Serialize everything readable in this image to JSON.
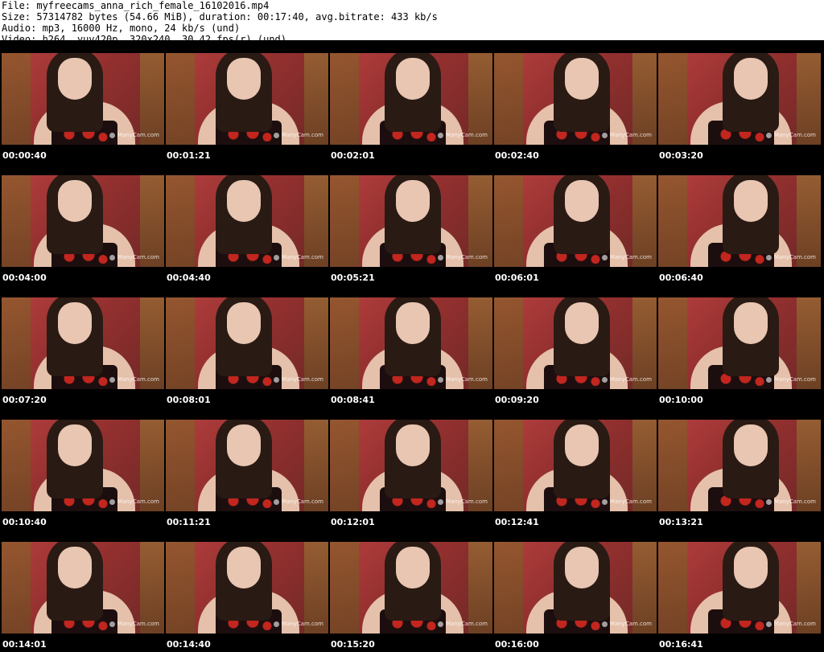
{
  "header": {
    "file": "File: myfreecams_anna_rich_female_16102016.mp4",
    "size": "Size: 57314782 bytes (54.66 MiB), duration: 00:17:40, avg.bitrate: 433 kb/s",
    "audio": "Audio: mp3, 16000 Hz, mono, 24 kb/s (und)",
    "video": "Video: h264, yuv420p, 320x240, 30.42 fps(r) (und)"
  },
  "watermark": "ManyCam.com",
  "rows": [
    [
      "00:00:40",
      "00:01:21",
      "00:02:01",
      "00:02:40",
      "00:03:20"
    ],
    [
      "00:04:00",
      "00:04:40",
      "00:05:21",
      "00:06:01",
      "00:06:40"
    ],
    [
      "00:07:20",
      "00:08:01",
      "00:08:41",
      "00:09:20",
      "00:10:00"
    ],
    [
      "00:10:40",
      "00:11:21",
      "00:12:01",
      "00:12:41",
      "00:13:21"
    ],
    [
      "00:14:01",
      "00:14:40",
      "00:15:20",
      "00:16:00",
      "00:16:41"
    ]
  ]
}
